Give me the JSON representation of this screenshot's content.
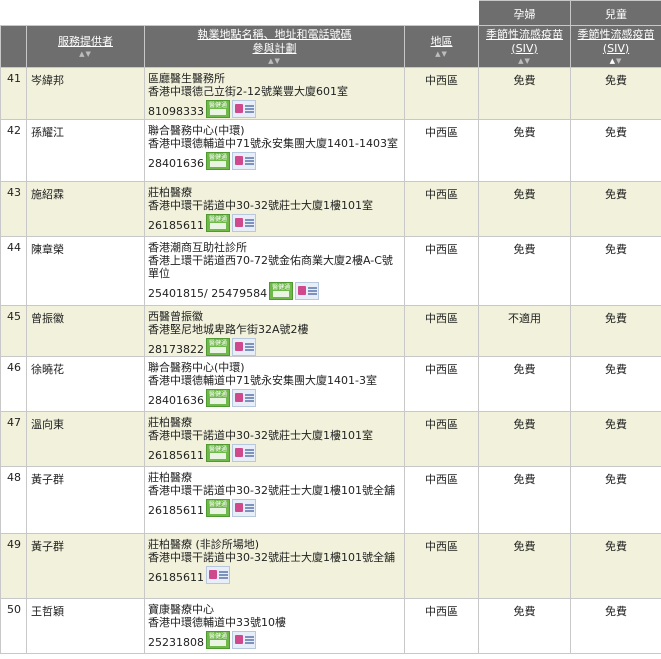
{
  "header": {
    "pregnant_group": "孕婦",
    "child_group": "兒童",
    "provider_label": "服務提供者",
    "address_label_line1": "執業地點名稱、地址和電話號碼",
    "address_label_line2": "參與計劃",
    "district_label": "地區",
    "pregnant_siv_line1": "季節性流感疫苗",
    "pregnant_siv_line2": "(SIV)",
    "child_siv_line1": "季節性流感疫苗",
    "child_siv_line2": "(SIV)"
  },
  "rows": [
    {
      "num": "41",
      "name": "岑緯邦",
      "clinic": "區廳醫生醫務所",
      "address": "香港中環德己立街2-12號業豐大廈601室",
      "phone": "81098333",
      "badges": [
        "ehr",
        "vss"
      ],
      "district": "中西區",
      "pregnant": "免費",
      "child": "免費",
      "alt": true
    },
    {
      "num": "42",
      "name": "孫耀江",
      "clinic": "聯合醫務中心(中環)",
      "address": "香港中環德輔道中71號永安集團大廈1401-1403室",
      "phone": "28401636",
      "badges": [
        "ehr",
        "vss"
      ],
      "district": "中西區",
      "pregnant": "免費",
      "child": "免費",
      "alt": false
    },
    {
      "num": "43",
      "name": "施紹霖",
      "clinic": "莊柏醫療",
      "address": "香港中環干諾道中30-32號莊士大廈1樓101室",
      "phone": "26185611",
      "badges": [
        "ehr",
        "vss"
      ],
      "district": "中西區",
      "pregnant": "免費",
      "child": "免費",
      "alt": true
    },
    {
      "num": "44",
      "name": "陳章榮",
      "clinic": "香港潮商互助社診所",
      "address": "香港上環干諾道西70-72號金佑商業大廈2樓A-C號單位",
      "phone": "25401815/ 25479584",
      "badges": [
        "ehr",
        "vss"
      ],
      "district": "中西區",
      "pregnant": "免費",
      "child": "免費",
      "alt": false
    },
    {
      "num": "45",
      "name": "曾振徽",
      "clinic": "西醫曾振徽",
      "address": "香港堅尼地城卑路乍街32A號2樓",
      "phone": "28173822",
      "badges": [
        "ehr",
        "vss"
      ],
      "district": "中西區",
      "pregnant": "不適用",
      "child": "免費",
      "alt": true
    },
    {
      "num": "46",
      "name": "徐曉花",
      "clinic": "聯合醫務中心(中環)",
      "address": "香港中環德輔道中71號永安集團大廈1401-3室",
      "phone": "28401636",
      "badges": [
        "ehr",
        "vss"
      ],
      "district": "中西區",
      "pregnant": "免費",
      "child": "免費",
      "alt": false
    },
    {
      "num": "47",
      "name": "溫向東",
      "clinic": "莊柏醫療",
      "address": "香港中環干諾道中30-32號莊士大廈1樓101室",
      "phone": "26185611",
      "badges": [
        "ehr",
        "vss"
      ],
      "district": "中西區",
      "pregnant": "免費",
      "child": "免費",
      "alt": true
    },
    {
      "num": "48",
      "name": "黃子群",
      "clinic": "莊柏醫療",
      "address": "香港中環干諾道中30-32號莊士大廈1樓101號全舖",
      "phone": "26185611",
      "badges": [
        "ehr",
        "vss"
      ],
      "district": "中西區",
      "pregnant": "免費",
      "child": "免費",
      "alt": false
    },
    {
      "num": "49",
      "name": "黃子群",
      "clinic": "莊柏醫療 (非診所場地)",
      "address": "香港中環干諾道中30-32號莊士大廈1樓101號全舖",
      "phone": "26185611",
      "badges": [
        "vss"
      ],
      "district": "中西區",
      "pregnant": "免費",
      "child": "免費",
      "alt": true
    },
    {
      "num": "50",
      "name": "王哲穎",
      "clinic": "寶康醫療中心",
      "address": "香港中環德輔道中33號10樓",
      "phone": "25231808",
      "badges": [
        "ehr",
        "vss"
      ],
      "district": "中西區",
      "pregnant": "免費",
      "child": "免費",
      "alt": false
    }
  ],
  "row_heights": null
}
